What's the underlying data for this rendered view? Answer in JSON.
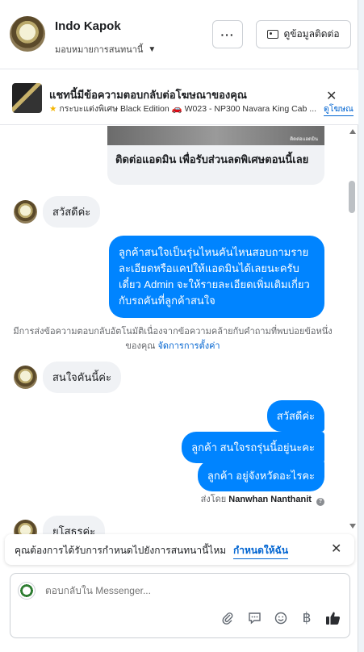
{
  "header": {
    "page_name": "Indo Kapok",
    "assign_label": "มอบหมายการสนทนานี้",
    "more_label": "···",
    "contact_label": "ดูข้อมูลติดต่อ"
  },
  "ad": {
    "title": "แชทนี้มีข้อความตอบกลับต่อโฆษณาของคุณ",
    "subtitle": "กระบะแต่งพิเศษ Black Edition 🚗 W023 - NP300 Navara King Cab ...",
    "link": "ดูโฆษณ"
  },
  "chat": {
    "card_image_label": "ติดต่อแอดมิน",
    "card_text": "ติดต่อแอดมิน เพื่อรับส่วนลดพิเศษตอนนี้เลย",
    "msg_in_1": "สวัสดีค่ะ",
    "msg_out_big": "ลูกค้าสนใจเป็นรุ่นไหนคันไหนสอบถามรายละเอียดหรือแคปให้แอดมินได้เลยนะครับ เดี๋ยว Admin จะให้รายละเอียดเพิ่มเติมเกี่ยวกับรถคันที่ลูกค้าสนใจ",
    "system_note": "มีการส่งข้อความตอบกลับอัตโนมัติเนื่องจากข้อความคล้ายกับคำถามที่พบบ่อยข้อหนึ่งของคุณ",
    "system_link": "จัดการการตั้งค่า",
    "msg_in_2": "สนใจคันนี้ค่ะ",
    "msg_out_1": "สวัสดีค่ะ",
    "msg_out_2": "ลูกค้า สนใจรถรุ่นนี้อยู่นะคะ",
    "msg_out_3": "ลูกค้า อยู่จังหวัดอะไรคะ",
    "sent_by_prefix": "ส่งโดย",
    "sent_by_name": "Nanwhan Nanthanit",
    "msg_in_3": "ยโสธรค่ะ"
  },
  "notice": {
    "text": "คุณต้องการได้รับการกำหนดไปยังการสนทนานี้ไหม",
    "link": "กำหนดให้ฉัน"
  },
  "composer": {
    "placeholder": "ตอบกลับใน Messenger..."
  },
  "colors": {
    "accent": "#0084ff",
    "link": "#0064d1",
    "bubble_in": "#f0f2f5"
  },
  "icons": [
    "paperclip-icon",
    "message-icon",
    "emoji-icon",
    "baht-icon",
    "thumbs-up-icon"
  ]
}
